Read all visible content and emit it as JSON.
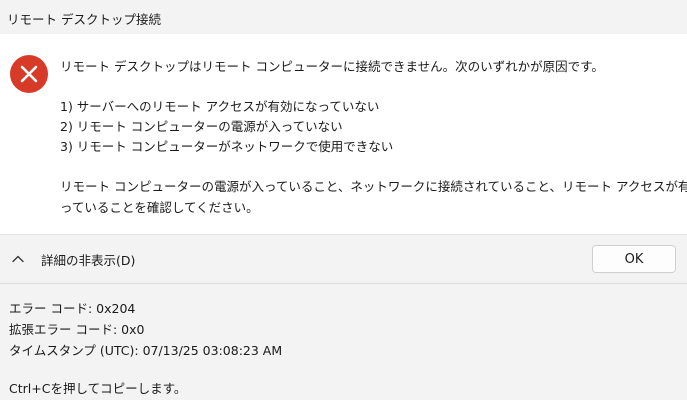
{
  "window": {
    "title": "リモート デスクトップ接続"
  },
  "icons": {
    "error": "error-x-circle-icon",
    "toggle": "chevron-up-icon"
  },
  "colors": {
    "error_icon_bg": "#d73a27",
    "panel_bg": "#f3f3f3",
    "body_bg": "#ffffff"
  },
  "message": {
    "intro": "リモート デスクトップはリモート コンピューターに接続できません。次のいずれかが原因です。",
    "reasons": [
      "1) サーバーへのリモート アクセスが有効になっていない",
      "2) リモート コンピューターの電源が入っていない",
      "3) リモート コンピューターがネットワークで使用できない"
    ],
    "advice_line1": "リモート コンピューターの電源が入っていること、ネットワークに接続されていること、リモート アクセスが有効にな",
    "advice_line2": "っていることを確認してください。"
  },
  "footer": {
    "details_toggle_label": "詳細の非表示(D)",
    "ok_label": "OK"
  },
  "details": {
    "error_code": "エラー コード: 0x204",
    "extended_error_code": "拡張エラー コード: 0x0",
    "timestamp": "タイムスタンプ (UTC): 07/13/25 03:08:23 AM",
    "copy_hint": "Ctrl+Cを押してコピーします。"
  }
}
